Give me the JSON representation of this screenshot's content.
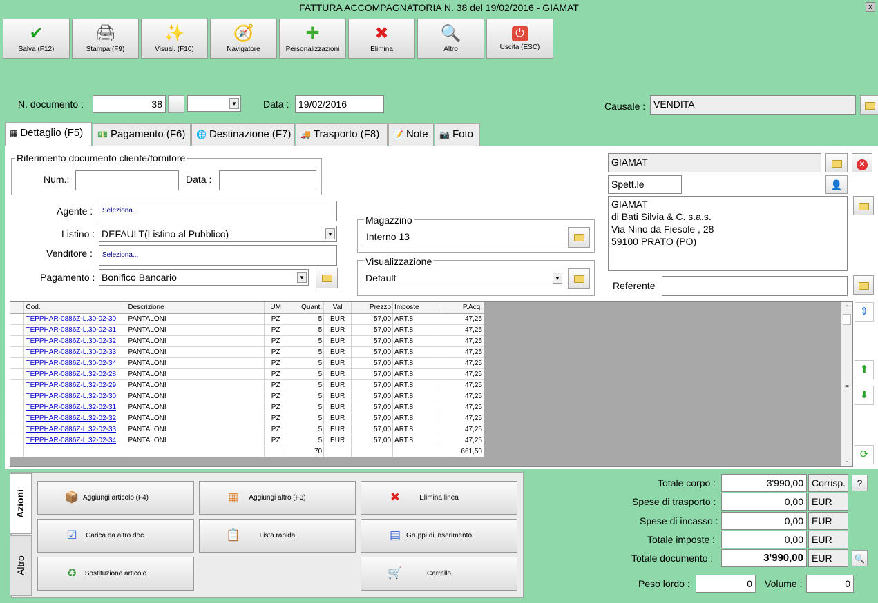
{
  "window": {
    "title": "FATTURA ACCOMPAGNATORIA N. 38 del 19/02/2016 - GIAMAT",
    "close": "x"
  },
  "toolbar": [
    {
      "label": "Salva (F12)",
      "icon": "check-icon",
      "glyph": "✔",
      "color": "#1e9e1e"
    },
    {
      "label": "Stampa (F9)",
      "icon": "printer-icon",
      "glyph": "🖨",
      "color": "#555"
    },
    {
      "label": "Visual. (F10)",
      "icon": "magic-wand-icon",
      "glyph": "✨",
      "color": "#b08a00"
    },
    {
      "label": "Navigatore",
      "icon": "compass-icon",
      "glyph": "🧭",
      "color": "#444"
    },
    {
      "label": "Personalizzazioni",
      "icon": "puzzle-icon",
      "glyph": "✚",
      "color": "#3cae2e"
    },
    {
      "label": "Elimina",
      "icon": "delete-x-icon",
      "glyph": "✖",
      "color": "#e02020"
    },
    {
      "label": "Altro",
      "icon": "magnifier-icon",
      "glyph": "🔍",
      "color": "#2a6fd6"
    },
    {
      "label": "Uscita (ESC)",
      "icon": "power-icon",
      "glyph": "⏻",
      "color": "#ffffff"
    }
  ],
  "header": {
    "ndoc_label": "N. documento :",
    "ndoc_value": "38",
    "data_label": "Data :",
    "data_value": "19/02/2016",
    "causale_label": "Causale :",
    "causale_value": "VENDITA"
  },
  "tabs": [
    {
      "label": "Dettaglio (F5)",
      "icon": "calendar-icon",
      "glyph": "▦"
    },
    {
      "label": "Pagamento (F6)",
      "icon": "money-icon",
      "glyph": "💵"
    },
    {
      "label": "Destinazione (F7)",
      "icon": "globe-icon",
      "glyph": "🌐"
    },
    {
      "label": "Trasporto (F8)",
      "icon": "truck-icon",
      "glyph": "🚚"
    },
    {
      "label": "Note",
      "icon": "note-icon",
      "glyph": "📝"
    },
    {
      "label": "Foto",
      "icon": "camera-icon",
      "glyph": "📷"
    }
  ],
  "riferimento": {
    "title": "Riferimento documento cliente/fornitore",
    "num_label": "Num.:",
    "data_label": "Data :",
    "num_value": "",
    "data_value": ""
  },
  "fields": {
    "agente_label": "Agente :",
    "agente_value": "Seleziona...",
    "listino_label": "Listino :",
    "listino_value": "DEFAULT(Listino al Pubblico)",
    "venditore_label": "Venditore :",
    "venditore_value": "Seleziona...",
    "pagamento_label": "Pagamento :",
    "pagamento_value": "Bonifico Bancario"
  },
  "magazzino": {
    "title": "Magazzino",
    "value": "Interno 13"
  },
  "visualizzazione": {
    "title": "Visualizzazione",
    "value": "Default"
  },
  "cliente": {
    "name": "GIAMAT",
    "salutation": "Spett.le",
    "address": [
      "GIAMAT",
      "di Bati Silvia & C. s.a.s.",
      "Via Nino da Fiesole , 28",
      "59100 PRATO (PO)"
    ],
    "referente_label": "Referente",
    "referente_value": ""
  },
  "grid": {
    "columns": [
      "Cod.",
      "Descrizione",
      "UM",
      "Quant.",
      "Val",
      "Prezzo",
      "Imposte",
      "P.Acq."
    ],
    "rows": [
      [
        "TEPPHAR-0886Z-L.30-02-30",
        "PANTALONI",
        "PZ",
        "5",
        "EUR",
        "57,00",
        "ART.8",
        "47,25"
      ],
      [
        "TEPPHAR-0886Z-L.30-02-31",
        "PANTALONI",
        "PZ",
        "5",
        "EUR",
        "57,00",
        "ART.8",
        "47,25"
      ],
      [
        "TEPPHAR-0886Z-L.30-02-32",
        "PANTALONI",
        "PZ",
        "5",
        "EUR",
        "57,00",
        "ART.8",
        "47,25"
      ],
      [
        "TEPPHAR-0886Z-L.30-02-33",
        "PANTALONI",
        "PZ",
        "5",
        "EUR",
        "57,00",
        "ART.8",
        "47,25"
      ],
      [
        "TEPPHAR-0886Z-L.30-02-34",
        "PANTALONI",
        "PZ",
        "5",
        "EUR",
        "57,00",
        "ART.8",
        "47,25"
      ],
      [
        "TEPPHAR-0886Z-L.32-02-28",
        "PANTALONI",
        "PZ",
        "5",
        "EUR",
        "57,00",
        "ART.8",
        "47,25"
      ],
      [
        "TEPPHAR-0886Z-L.32-02-29",
        "PANTALONI",
        "PZ",
        "5",
        "EUR",
        "57,00",
        "ART.8",
        "47,25"
      ],
      [
        "TEPPHAR-0886Z-L.32-02-30",
        "PANTALONI",
        "PZ",
        "5",
        "EUR",
        "57,00",
        "ART.8",
        "47,25"
      ],
      [
        "TEPPHAR-0886Z-L.32-02-31",
        "PANTALONI",
        "PZ",
        "5",
        "EUR",
        "57,00",
        "ART.8",
        "47,25"
      ],
      [
        "TEPPHAR-0886Z-L.32-02-32",
        "PANTALONI",
        "PZ",
        "5",
        "EUR",
        "57,00",
        "ART.8",
        "47,25"
      ],
      [
        "TEPPHAR-0886Z-L.32-02-33",
        "PANTALONI",
        "PZ",
        "5",
        "EUR",
        "57,00",
        "ART.8",
        "47,25"
      ],
      [
        "TEPPHAR-0886Z-L.32-02-34",
        "PANTALONI",
        "PZ",
        "5",
        "EUR",
        "57,00",
        "ART.8",
        "47,25"
      ]
    ],
    "footer": {
      "quant": "70",
      "pacq": "661,50"
    }
  },
  "side_tabs": {
    "azioni": "Azioni",
    "altro": "Altro"
  },
  "actions": [
    {
      "label": "Aggiungi articolo (F4)",
      "icon": "add-article-icon",
      "glyph": "📦"
    },
    {
      "label": "Aggiungi altro (F3)",
      "icon": "add-other-icon",
      "glyph": "▦"
    },
    {
      "label": "Elimina linea",
      "icon": "delete-line-icon",
      "glyph": "✖"
    },
    {
      "label": "Carica da altro doc.",
      "icon": "load-doc-icon",
      "glyph": "☑"
    },
    {
      "label": "Lista rapida",
      "icon": "quick-list-icon",
      "glyph": "📋"
    },
    {
      "label": "Gruppi di inserimento",
      "icon": "insert-groups-icon",
      "glyph": "▤"
    },
    {
      "label": "Sostituzione articolo",
      "icon": "replace-article-icon",
      "glyph": "♻"
    },
    {
      "label": "Carrello",
      "icon": "cart-icon",
      "glyph": "🛒"
    }
  ],
  "totals": {
    "corpo_label": "Totale corpo :",
    "corpo_value": "3'990,00",
    "corpo_unit": "Corrisp.",
    "help": "?",
    "trasporto_label": "Spese di trasporto :",
    "trasporto_value": "0,00",
    "trasporto_unit": "EUR",
    "incasso_label": "Spese di incasso :",
    "incasso_value": "0,00",
    "incasso_unit": "EUR",
    "imposte_label": "Totale imposte :",
    "imposte_value": "0,00",
    "imposte_unit": "EUR",
    "documento_label": "Totale documento :",
    "documento_value": "3'990,00",
    "documento_unit": "EUR",
    "peso_label": "Peso lordo :",
    "peso_value": "0",
    "volume_label": "Volume :",
    "volume_value": "0"
  }
}
